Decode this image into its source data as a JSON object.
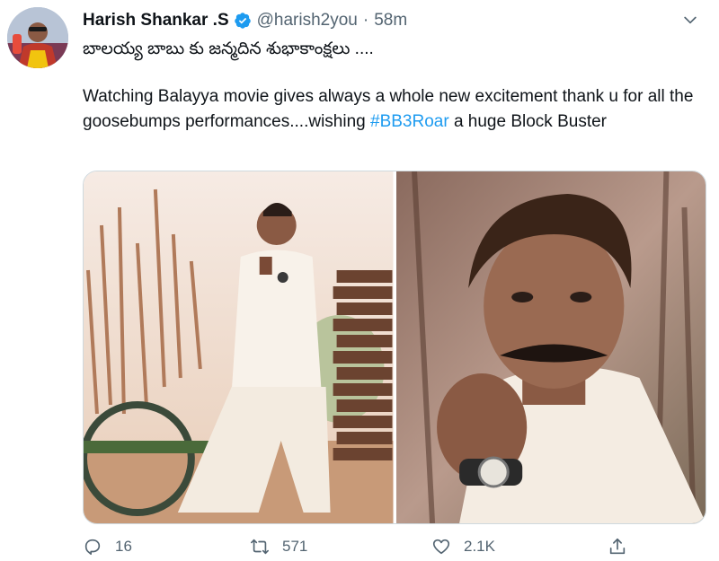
{
  "tweet": {
    "author_name": "Harish Shankar .S",
    "handle": "@harish2you",
    "separator": "·",
    "time": "58m",
    "line_telugu": "బాలయ్య బాబు కు జన్మదిన శుభాకాంక్షలు ....",
    "text_before_hashtag": "Watching Balayya movie gives always a whole new excitement thank u for all the goosebumps performances....wishing ",
    "hashtag": "#BB3Roar",
    "text_after_hashtag": " a huge Block Buster",
    "hashtag_color": "#1d9bf0"
  },
  "icons": {
    "verified": "verified-badge-icon",
    "more": "chevron-down-icon",
    "reply": "reply-icon",
    "retweet": "retweet-icon",
    "like": "heart-icon",
    "share": "share-icon"
  },
  "actions": {
    "reply_count": "16",
    "retweet_count": "571",
    "like_count": "2.1K"
  },
  "colors": {
    "text": "#0f1419",
    "secondary": "#536471",
    "accent": "#1d9bf0",
    "border": "#cfd9de"
  }
}
